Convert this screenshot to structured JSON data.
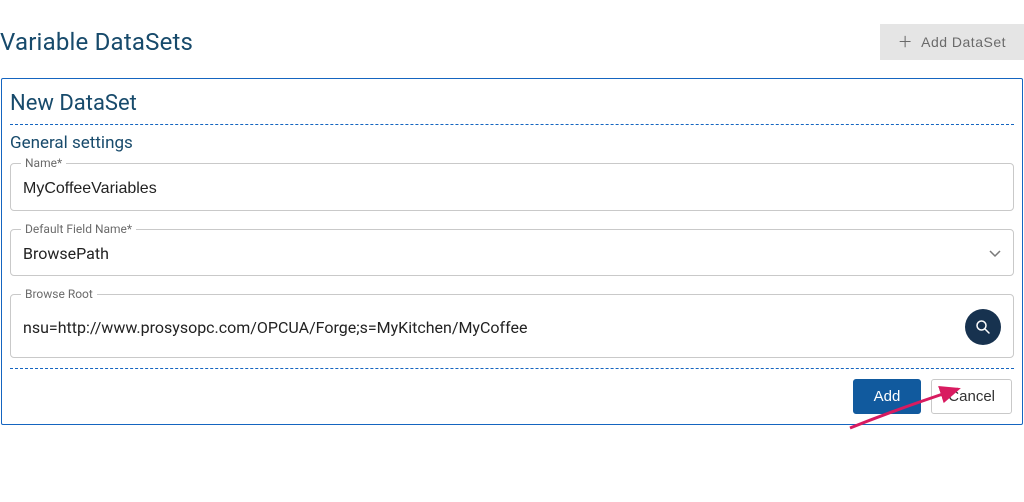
{
  "header": {
    "title": "Variable DataSets",
    "add_button_label": "Add DataSet"
  },
  "panel": {
    "title": "New DataSet",
    "section_title": "General settings",
    "fields": {
      "name": {
        "label": "Name*",
        "value": "MyCoffeeVariables"
      },
      "default_field_name": {
        "label": "Default Field Name*",
        "value": "BrowsePath"
      },
      "browse_root": {
        "label": "Browse Root",
        "value": "nsu=http://www.prosysopc.com/OPCUA/Forge;s=MyKitchen/MyCoffee"
      }
    }
  },
  "footer": {
    "add_label": "Add",
    "cancel_label": "Cancel"
  },
  "colors": {
    "accent": "#115a9e",
    "panel_border": "#1565c0",
    "heading": "#174a6b",
    "search_bg": "#17324f",
    "arrow": "#d81b60"
  }
}
